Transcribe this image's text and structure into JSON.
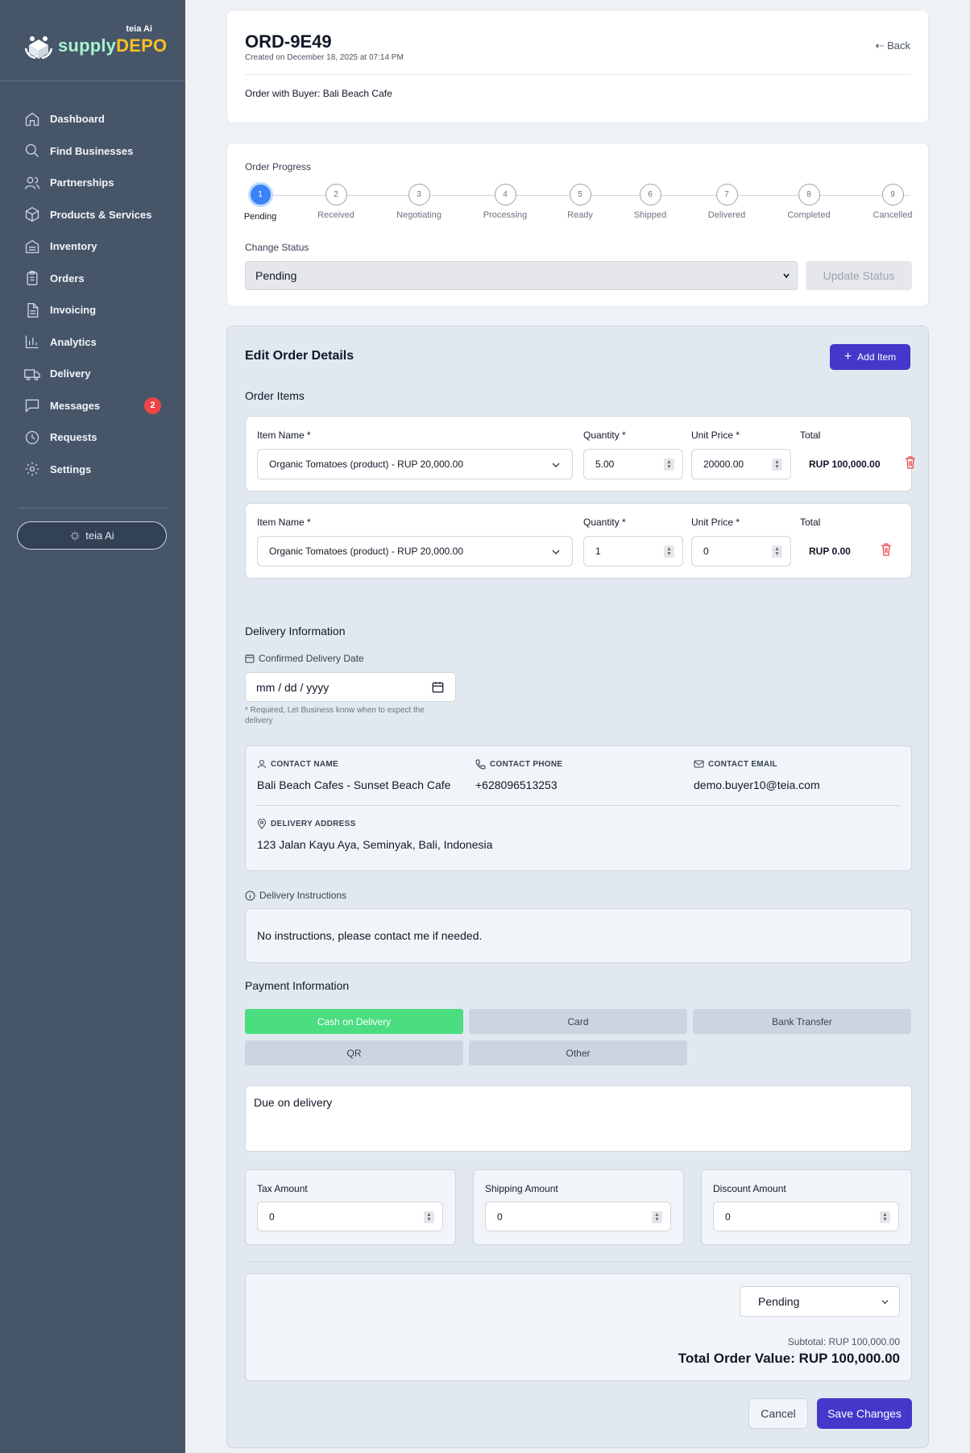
{
  "brand": {
    "tag": "teia Ai",
    "name_part1": "supply",
    "name_part2": "DEPO"
  },
  "sidebar": {
    "items": [
      {
        "label": "Dashboard",
        "icon": "home-icon"
      },
      {
        "label": "Find Businesses",
        "icon": "search-icon"
      },
      {
        "label": "Partnerships",
        "icon": "users-icon"
      },
      {
        "label": "Products & Services",
        "icon": "package-icon"
      },
      {
        "label": "Inventory",
        "icon": "warehouse-icon"
      },
      {
        "label": "Orders",
        "icon": "clipboard-icon"
      },
      {
        "label": "Invoicing",
        "icon": "file-icon"
      },
      {
        "label": "Analytics",
        "icon": "bar-chart-icon"
      },
      {
        "label": "Delivery",
        "icon": "truck-icon"
      },
      {
        "label": "Messages",
        "icon": "message-icon",
        "badge": "2"
      },
      {
        "label": "Requests",
        "icon": "clock-icon"
      },
      {
        "label": "Settings",
        "icon": "gear-icon"
      }
    ],
    "ai_button": "teia Ai"
  },
  "header": {
    "order_id": "ORD-9E49",
    "created": "Created on December 18, 2025 at 07:14 PM",
    "back": "Back",
    "buyer": "Order with Buyer: Bali Beach Cafe"
  },
  "progress": {
    "title": "Order Progress",
    "steps": [
      {
        "num": "1",
        "label": "Pending"
      },
      {
        "num": "2",
        "label": "Received"
      },
      {
        "num": "3",
        "label": "Negotiating"
      },
      {
        "num": "4",
        "label": "Processing"
      },
      {
        "num": "5",
        "label": "Ready"
      },
      {
        "num": "6",
        "label": "Shipped"
      },
      {
        "num": "7",
        "label": "Delivered"
      },
      {
        "num": "8",
        "label": "Completed"
      },
      {
        "num": "9",
        "label": "Cancelled"
      }
    ],
    "active_step": 1,
    "change_status_label": "Change Status",
    "status_value": "Pending",
    "update_button": "Update Status"
  },
  "edit": {
    "title": "Edit Order Details",
    "add_item": "Add Item",
    "items_title": "Order Items",
    "labels": {
      "item_name": "Item Name *",
      "quantity": "Quantity *",
      "unit_price": "Unit Price *",
      "total": "Total"
    },
    "items": [
      {
        "name": "Organic Tomatoes (product) - RUP 20,000.00",
        "quantity": "5.00",
        "unit_price": "20000.00",
        "total": "RUP 100,000.00"
      },
      {
        "name": "Organic Tomatoes (product) - RUP 20,000.00",
        "quantity": "1",
        "unit_price": "0",
        "total": "RUP 0.00"
      }
    ]
  },
  "delivery": {
    "title": "Delivery Information",
    "date_label": "Confirmed Delivery Date",
    "date_placeholder": "mm / dd / yyyy",
    "hint": "* Required, Let Business know when to expect the delivery",
    "contact_name_label": "CONTACT NAME",
    "contact_name": "Bali Beach Cafes - Sunset Beach Cafe",
    "contact_phone_label": "CONTACT PHONE",
    "contact_phone": "+628096513253",
    "contact_email_label": "CONTACT EMAIL",
    "contact_email": "demo.buyer10@teia.com",
    "address_label": "DELIVERY ADDRESS",
    "address": "123 Jalan Kayu Aya, Seminyak, Bali, Indonesia",
    "instructions_label": "Delivery Instructions",
    "instructions": "No instructions, please contact me if needed."
  },
  "payment": {
    "title": "Payment Information",
    "methods": [
      "Cash on Delivery",
      "Card",
      "Bank Transfer",
      "QR",
      "Other"
    ],
    "selected": "Cash on Delivery",
    "notes": "Due on delivery",
    "tax_label": "Tax Amount",
    "tax_value": "0",
    "shipping_label": "Shipping Amount",
    "shipping_value": "0",
    "discount_label": "Discount Amount",
    "discount_value": "0"
  },
  "summary": {
    "status": "Pending",
    "subtotal": "Subtotal: RUP 100,000.00",
    "total": "Total Order Value: RUP 100,000.00",
    "cancel": "Cancel",
    "save": "Save Changes"
  },
  "colors": {
    "sidebar": "#475569",
    "accent": "#4338ca",
    "step_active": "#3b82f6",
    "payment_selected": "#4ade80",
    "badge": "#ef4444"
  }
}
